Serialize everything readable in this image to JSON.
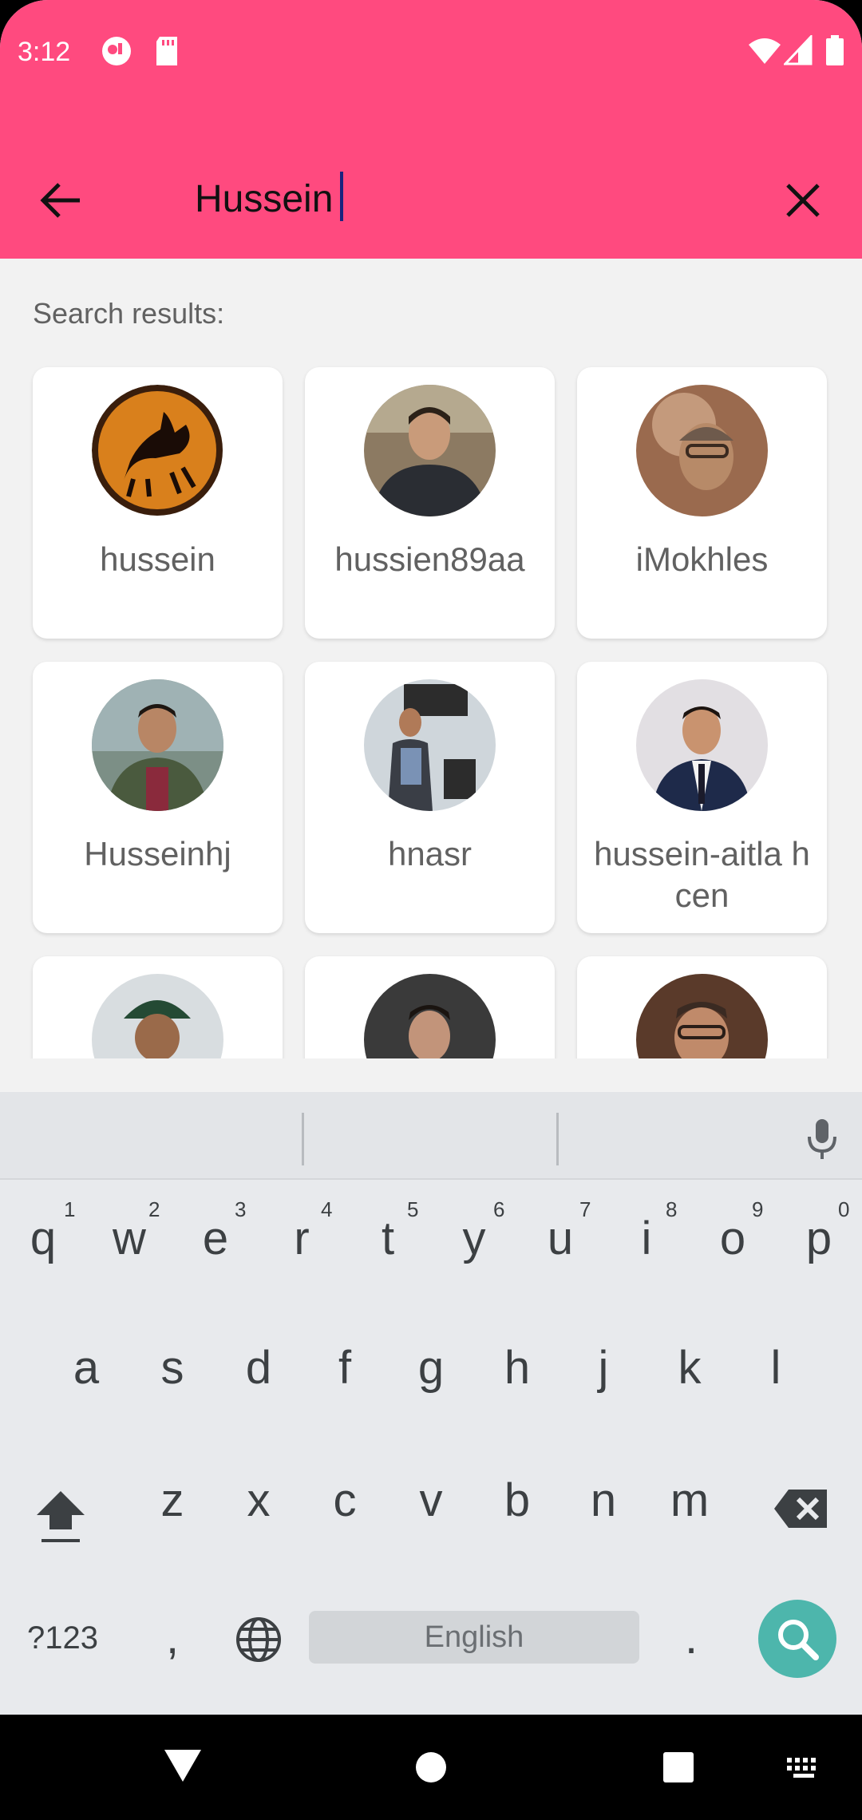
{
  "status_bar": {
    "time": "3:12"
  },
  "search": {
    "query": "Hussein"
  },
  "results": {
    "label": "Search results:",
    "users": [
      {
        "name": "hussein"
      },
      {
        "name": "hussien89aa"
      },
      {
        "name": "iMokhles"
      },
      {
        "name": "Husseinhj"
      },
      {
        "name": "hnasr"
      },
      {
        "name": "hussein-aitla hcen"
      },
      {
        "name": ""
      },
      {
        "name": ""
      },
      {
        "name": ""
      }
    ]
  },
  "keyboard": {
    "row1": [
      "q",
      "w",
      "e",
      "r",
      "t",
      "y",
      "u",
      "i",
      "o",
      "p"
    ],
    "row1_hints": [
      "1",
      "2",
      "3",
      "4",
      "5",
      "6",
      "7",
      "8",
      "9",
      "0"
    ],
    "row2": [
      "a",
      "s",
      "d",
      "f",
      "g",
      "h",
      "j",
      "k",
      "l"
    ],
    "row3": [
      "z",
      "x",
      "c",
      "v",
      "b",
      "n",
      "m"
    ],
    "symbols_label": "?123",
    "comma": ",",
    "period": ".",
    "space_label": "English"
  },
  "colors": {
    "accent": "#ff4a7f",
    "search_key": "#4db6ac"
  }
}
